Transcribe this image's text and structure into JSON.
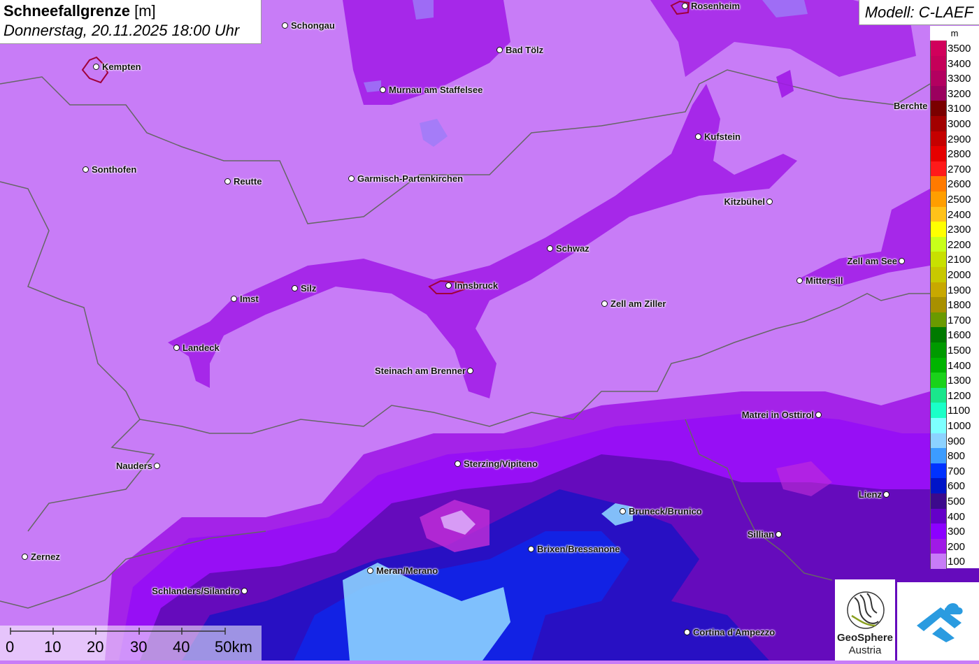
{
  "title": {
    "parameter": "Schneefallgrenze",
    "unit": "[m]",
    "datetime": "Donnerstag, 20.11.2025 18:00 Uhr"
  },
  "model": "Modell: C-LAEF",
  "legend": {
    "unit": "m",
    "items": [
      {
        "label": "3500",
        "color": "#d1005b"
      },
      {
        "label": "3400",
        "color": "#c50059"
      },
      {
        "label": "3300",
        "color": "#b30060"
      },
      {
        "label": "3200",
        "color": "#9b005e"
      },
      {
        "label": "3100",
        "color": "#7a0000"
      },
      {
        "label": "3000",
        "color": "#a30000"
      },
      {
        "label": "2900",
        "color": "#c50000"
      },
      {
        "label": "2800",
        "color": "#e60000"
      },
      {
        "label": "2700",
        "color": "#ff1a1a"
      },
      {
        "label": "2600",
        "color": "#ff7a00"
      },
      {
        "label": "2500",
        "color": "#ff9e00"
      },
      {
        "label": "2400",
        "color": "#ffc21a"
      },
      {
        "label": "2300",
        "color": "#ffff00"
      },
      {
        "label": "2200",
        "color": "#c8ff1a"
      },
      {
        "label": "2100",
        "color": "#c8e000"
      },
      {
        "label": "2000",
        "color": "#c8c800"
      },
      {
        "label": "1900",
        "color": "#c8a800"
      },
      {
        "label": "1800",
        "color": "#a89000"
      },
      {
        "label": "1700",
        "color": "#6a9a00"
      },
      {
        "label": "1600",
        "color": "#007a00"
      },
      {
        "label": "1500",
        "color": "#009a00"
      },
      {
        "label": "1400",
        "color": "#00b400"
      },
      {
        "label": "1300",
        "color": "#1ad21a"
      },
      {
        "label": "1200",
        "color": "#1ae68c"
      },
      {
        "label": "1100",
        "color": "#1affc8"
      },
      {
        "label": "1000",
        "color": "#7dffff"
      },
      {
        "label": "900",
        "color": "#8cd2ff"
      },
      {
        "label": "800",
        "color": "#3c9cff"
      },
      {
        "label": "700",
        "color": "#0032ff"
      },
      {
        "label": "600",
        "color": "#0014c8"
      },
      {
        "label": "500",
        "color": "#3c0a8c"
      },
      {
        "label": "400",
        "color": "#6400c8"
      },
      {
        "label": "300",
        "color": "#8c00ff"
      },
      {
        "label": "200",
        "color": "#a01ae6"
      },
      {
        "label": "100",
        "color": "#c87cf7"
      }
    ]
  },
  "scalebar": {
    "ticks": [
      "0",
      "10",
      "20",
      "30",
      "40"
    ],
    "last": "50km"
  },
  "logos": {
    "geosphere_line1": "GeoSphere",
    "geosphere_line2": "Austria"
  },
  "cities": [
    {
      "name": "Schongau"
    },
    {
      "name": "Rosenheim"
    },
    {
      "name": "Kempten"
    },
    {
      "name": "Bad Tölz"
    },
    {
      "name": "Murnau am Staffelsee"
    },
    {
      "name": "Berchte"
    },
    {
      "name": "Kufstein"
    },
    {
      "name": "Sonthofen"
    },
    {
      "name": "Reutte"
    },
    {
      "name": "Garmisch-Partenkirchen"
    },
    {
      "name": "Kitzbühel"
    },
    {
      "name": "Schwaz"
    },
    {
      "name": "Zell am See"
    },
    {
      "name": "Mittersill"
    },
    {
      "name": "Imst"
    },
    {
      "name": "Silz"
    },
    {
      "name": "Innsbruck"
    },
    {
      "name": "Zell am Ziller"
    },
    {
      "name": "Landeck"
    },
    {
      "name": "Steinach am Brenner"
    },
    {
      "name": "Matrei in Osttirol"
    },
    {
      "name": "Nauders"
    },
    {
      "name": "Sterzing/Vipiteno"
    },
    {
      "name": "Lienz"
    },
    {
      "name": "Bruneck/Brunico"
    },
    {
      "name": "Sillian"
    },
    {
      "name": "Brixen/Bressanone"
    },
    {
      "name": "Zernez"
    },
    {
      "name": "Meran/Merano"
    },
    {
      "name": "Schlanders/Silandro"
    },
    {
      "name": "Cortina d'Ampezzo"
    }
  ]
}
